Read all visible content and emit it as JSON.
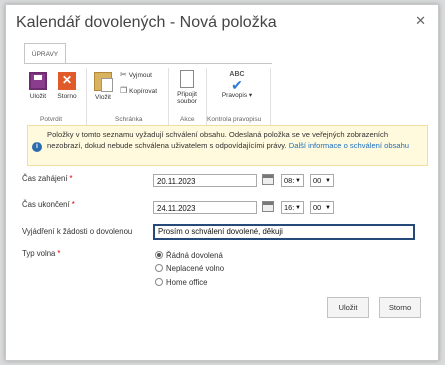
{
  "dialog": {
    "title": "Kalendář dovolených - Nová položka",
    "close_glyph": "✕"
  },
  "ribbon": {
    "tab": "ÚPRAVY",
    "groups": {
      "commit": {
        "label": "Potvrdit",
        "save": "Uložit",
        "cancel": "Storno"
      },
      "clipboard": {
        "label": "Schránka",
        "paste": "Vložit",
        "cut": "Vyjmout",
        "copy": "Kopírovat"
      },
      "actions": {
        "label": "Akce",
        "attach_line1": "Připojit",
        "attach_line2": "soubor"
      },
      "spelling": {
        "label": "Kontrola pravopisu",
        "abc": "ABC",
        "spell": "Pravopis"
      }
    }
  },
  "info": {
    "text": "Položky v tomto seznamu vyžadují schválení obsahu. Odeslaná položka se ve veřejných zobrazeních nezobrazí, dokud nebude schválena uživatelem s odpovídajícími právy. ",
    "link": "Další informace o schválení obsahu"
  },
  "form": {
    "start": {
      "label": "Čas zahájení",
      "required": "*",
      "date": "20.11.2023",
      "hour": "08:",
      "minute": "00"
    },
    "end": {
      "label": "Čas ukončení",
      "required": "*",
      "date": "24.11.2023",
      "hour": "16:",
      "minute": "00"
    },
    "comment": {
      "label": "Vyjádření k žádosti o dovolenou",
      "value": "Prosím o schválení dovolené, děkuji"
    },
    "type": {
      "label": "Typ volna",
      "required": "*",
      "options": [
        {
          "label": "Řádná dovolená",
          "selected": true
        },
        {
          "label": "Neplacené volno",
          "selected": false
        },
        {
          "label": "Home office",
          "selected": false
        }
      ]
    }
  },
  "footer": {
    "save": "Uložit",
    "cancel": "Storno"
  }
}
